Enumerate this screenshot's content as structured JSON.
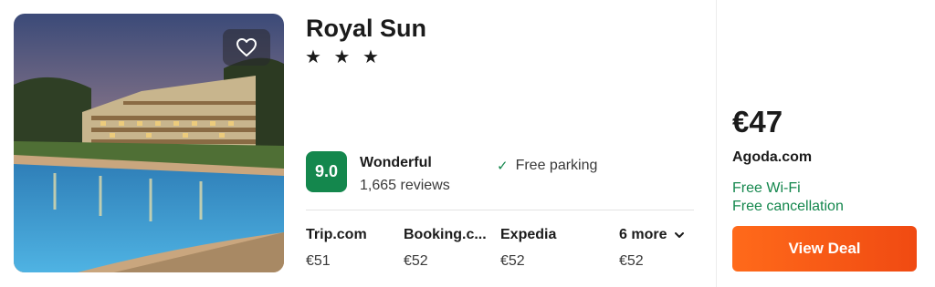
{
  "hotel": {
    "name": "Royal Sun",
    "stars": "★ ★ ★",
    "star_count": 3
  },
  "rating": {
    "score": "9.0",
    "label": "Wonderful",
    "reviews": "1,665 reviews"
  },
  "amenities": [
    {
      "icon": "checkmark-icon",
      "label": "Free parking"
    }
  ],
  "providers": [
    {
      "name": "Trip.com",
      "price": "€51"
    },
    {
      "name": "Booking.c...",
      "price": "€52"
    },
    {
      "name": "Expedia",
      "price": "€52"
    },
    {
      "name": "6 more",
      "price": "€52",
      "icon": "chevron-down-icon"
    }
  ],
  "deal": {
    "price": "€47",
    "site": "Agoda.com",
    "perks": [
      "Free Wi-Fi",
      "Free cancellation"
    ],
    "button_label": "View Deal"
  },
  "colors": {
    "score_badge": "#14874d",
    "perk_text": "#14874d",
    "deal_button": "#f25a15"
  }
}
